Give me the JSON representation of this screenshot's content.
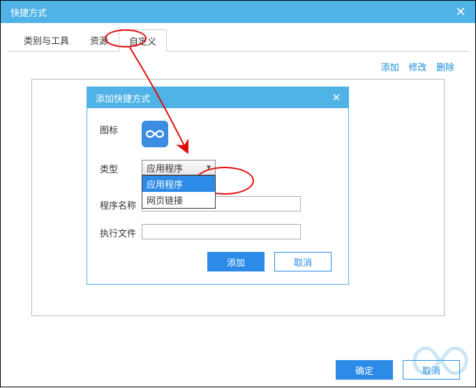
{
  "window": {
    "title": "快捷方式"
  },
  "tabs": {
    "items": [
      "类别与工具",
      "资源",
      "自定义"
    ],
    "activeIndex": 2
  },
  "actions": {
    "add": "添加",
    "edit": "修改",
    "delete": "删除"
  },
  "dialog": {
    "title": "添加快捷方式",
    "labels": {
      "icon": "图标",
      "type": "类型",
      "programName": "程序名称",
      "execFile": "执行文件"
    },
    "type": {
      "selected": "应用程序",
      "options": [
        "应用程序",
        "网页链接"
      ]
    },
    "programName": "",
    "execFile": "",
    "buttons": {
      "add": "添加",
      "cancel": "取消"
    }
  },
  "footer": {
    "ok": "确定",
    "cancel": "取消"
  }
}
